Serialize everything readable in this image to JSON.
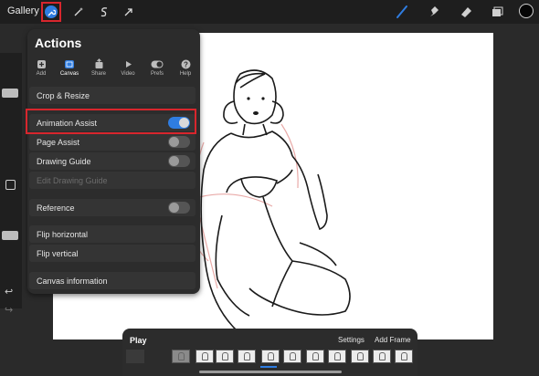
{
  "topbar": {
    "gallery_label": "Gallery",
    "tools": [
      "actions-wrench-icon",
      "adjustments-wand-icon",
      "selection-s-icon",
      "transform-arrow-icon"
    ],
    "right_tools": [
      "brush-icon",
      "smudge-icon",
      "eraser-icon",
      "layers-icon"
    ],
    "brush_color": "#2f7de1",
    "swatch_color": "#050505"
  },
  "actions_panel": {
    "title": "Actions",
    "tabs": [
      {
        "label": "Add",
        "icon": "plus-icon"
      },
      {
        "label": "Canvas",
        "icon": "canvas-icon",
        "active": true
      },
      {
        "label": "Share",
        "icon": "share-icon"
      },
      {
        "label": "Video",
        "icon": "video-icon"
      },
      {
        "label": "Prefs",
        "icon": "toggle-icon"
      },
      {
        "label": "Help",
        "icon": "help-icon"
      }
    ],
    "rows": {
      "crop": "Crop & Resize",
      "animation_assist": {
        "label": "Animation Assist",
        "on": true
      },
      "page_assist": {
        "label": "Page Assist",
        "on": false
      },
      "drawing_guide": {
        "label": "Drawing Guide",
        "on": false
      },
      "edit_drawing_guide": "Edit Drawing Guide",
      "reference": {
        "label": "Reference",
        "on": false
      },
      "flip_horizontal": "Flip horizontal",
      "flip_vertical": "Flip vertical",
      "canvas_information": "Canvas information"
    }
  },
  "timeline": {
    "play": "Play",
    "settings": "Settings",
    "add_frame": "Add Frame",
    "frame_count": 11,
    "selected_frame": 1
  },
  "accent": "#2f7de1",
  "highlight_color": "#d8262d"
}
